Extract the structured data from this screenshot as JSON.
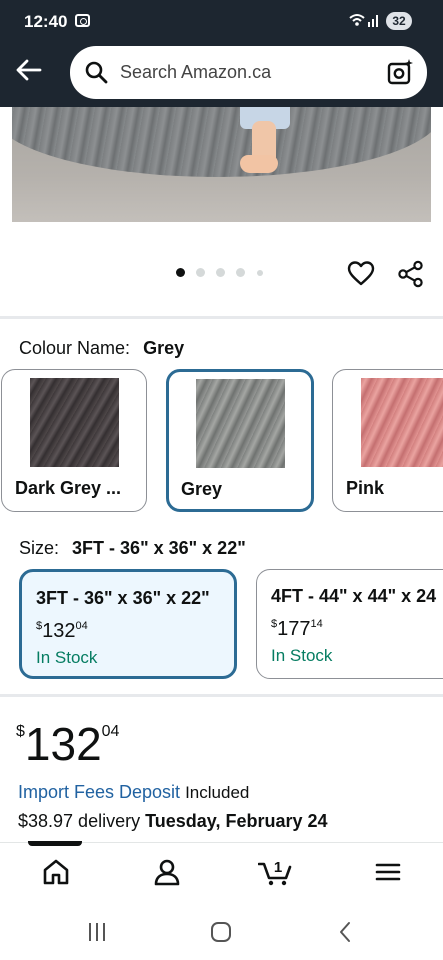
{
  "status_bar": {
    "time": "12:40",
    "battery": "32"
  },
  "search": {
    "placeholder": "Search Amazon.ca"
  },
  "gallery": {
    "dot_count": 5,
    "active_dot": 1
  },
  "colour": {
    "label": "Colour Name:",
    "selected": "Grey",
    "options": [
      {
        "name": "Dark Grey ...",
        "swatch_color": "#4a4446"
      },
      {
        "name": "Grey",
        "swatch_color": "#8a8c8a"
      },
      {
        "name": "Pink",
        "swatch_color": "#d88a88"
      }
    ]
  },
  "size": {
    "label": "Size:",
    "selected": "3FT - 36\" x 36\" x 22\"",
    "options": [
      {
        "title": "3FT - 36\" x 36\" x 22\"",
        "price_currency": "$",
        "price_whole": "132",
        "price_fraction": "04",
        "stock": "In Stock"
      },
      {
        "title": "4FT - 44\" x 44\" x 24",
        "price_currency": "$",
        "price_whole": "177",
        "price_fraction": "14",
        "stock": "In Stock"
      }
    ]
  },
  "price": {
    "currency": "$",
    "whole": "132",
    "fraction": "04"
  },
  "import_fees": {
    "link": "Import Fees Deposit",
    "suffix": "Included"
  },
  "delivery": {
    "prefix": "$38.97 delivery",
    "date": "Tuesday, February 24"
  },
  "cart": {
    "count": "1"
  },
  "colors": {
    "header_bg": "#1d2630",
    "selected_border": "#2c6b94",
    "link": "#2162a1",
    "in_stock": "#067d62"
  }
}
